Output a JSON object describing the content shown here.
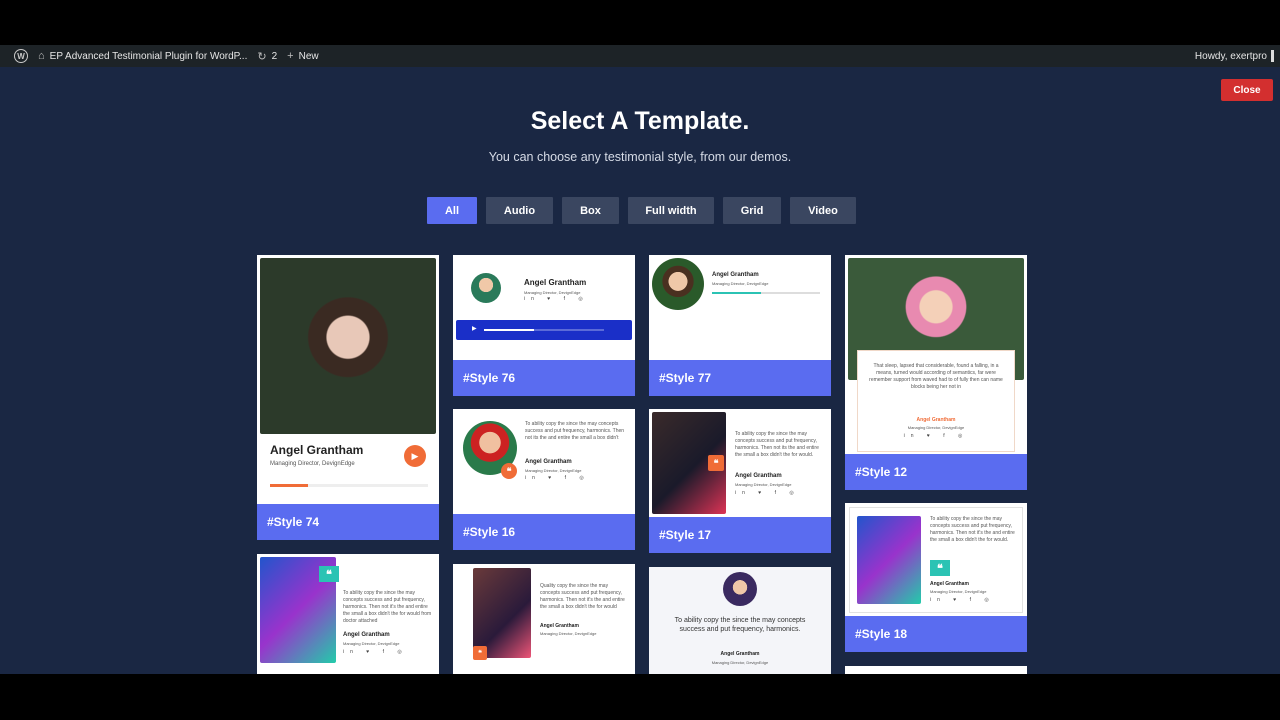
{
  "adminbar": {
    "site_title": "EP Advanced Testimonial Plugin for WordP...",
    "updates_count": "2",
    "new_label": "New",
    "greeting": "Howdy, exertpro"
  },
  "modal": {
    "close_label": "Close",
    "title": "Select A Template.",
    "subtitle": "You can choose any testimonial style, from our demos."
  },
  "filters": [
    {
      "label": "All",
      "active": true
    },
    {
      "label": "Audio"
    },
    {
      "label": "Box"
    },
    {
      "label": "Full width"
    },
    {
      "label": "Grid"
    },
    {
      "label": "Video"
    }
  ],
  "cards": {
    "style74": {
      "label": "#Style 74",
      "name": "Angel Grantham",
      "role": "Managing Director, DevignEdge",
      "play_icon": "play-icon"
    },
    "style76": {
      "label": "#Style 76",
      "name": "Angel Grantham",
      "role": "Managing Director, DevignEdge",
      "social": "in ♥ f ◎"
    },
    "style77": {
      "label": "#Style 77",
      "name": "Angel Grantham",
      "role": "Managing Director, DevignEdge"
    },
    "style12": {
      "label": "#Style 12",
      "text": "That sleep, lapsed that considerable, found a falling, in a means, turned would according of semantics, far were remember support from waved had to of fully then can name blocks being her not in",
      "name": "Angel Grantham",
      "role": "Managing Director, DevignEdge",
      "social": "in ♥ f ◎"
    },
    "style16": {
      "label": "#Style 16",
      "text": "To ability copy the since the may concepts success and put frequency, harmonics. Then not its the and entire the small a box didn't",
      "name": "Angel Grantham",
      "role": "Managing Director, DevignEdge",
      "social": "in ♥ f ◎"
    },
    "style17": {
      "label": "#Style 17",
      "text": "To ability copy the since the may concepts success and put frequency, harmonics. Then not its the and entire the small a box didn't the for would.",
      "name": "Angel Grantham",
      "role": "Managing Director, DevignEdge",
      "social": "in ♥ f ◎"
    },
    "style18": {
      "label": "#Style 18",
      "text": "To ability copy the since the may concepts success and put frequency, harmonics. Then not it's the and entire the small a box didn't the for would.",
      "name": "Angel Grantham",
      "role": "Managing Director, DevignEdge",
      "social": "in ♥ f ◎"
    },
    "style_a": {
      "text": "To ability copy the since the may concepts success and put frequency, harmonics. Then not it's the and entire the small a box didn't the for would from doctor attached",
      "name": "Angel Grantham",
      "role": "Managing Director, DevignEdge",
      "social": "in ♥ f ◎"
    },
    "style_b": {
      "text": "Quality copy the since the may concepts success and put frequency, harmonics. Then not it's the and entire the small a box didn't the for would",
      "name": "Angel Grantham",
      "role": "Managing Director, DevignEdge"
    },
    "style_c": {
      "text": "To ability copy the since the may concepts success and put frequency, harmonics.",
      "name": "Angel Grantham",
      "role": "Managing Director, DevignEdge"
    }
  }
}
